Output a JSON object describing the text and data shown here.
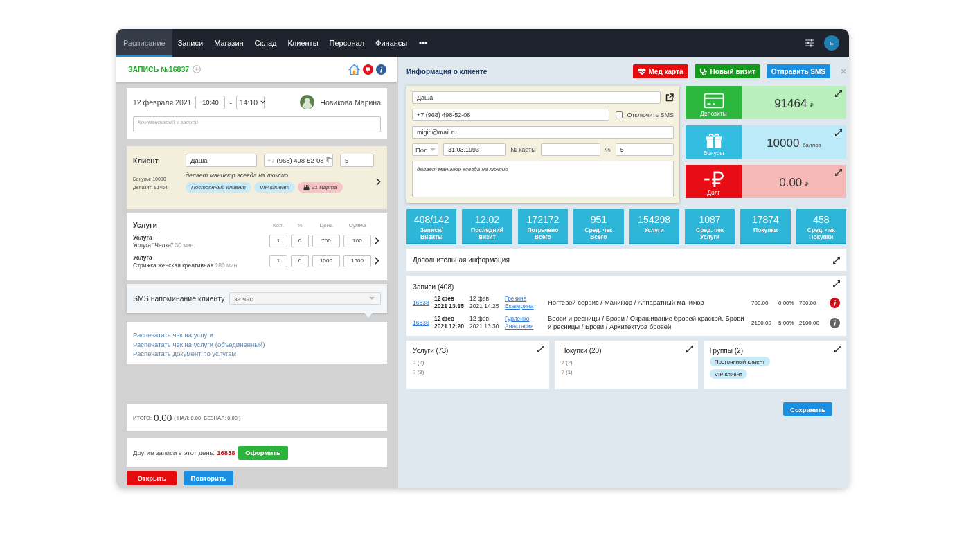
{
  "nav": {
    "tabs": [
      {
        "label": "Расписание",
        "selected": true
      },
      {
        "label": "Записи",
        "selected": false
      },
      {
        "label": "Магазин",
        "selected": false
      },
      {
        "label": "Склад",
        "selected": false
      },
      {
        "label": "Клиенты",
        "selected": false
      },
      {
        "label": "Персонал",
        "selected": false
      },
      {
        "label": "Финансы",
        "selected": false
      }
    ],
    "user_initial": "E"
  },
  "appointment": {
    "title": "ЗАПИСЬ №16837",
    "date": "12 февраля 2021",
    "time_start": "10:40",
    "time_separator": "-",
    "time_end": "14:10",
    "master": "Новикова Марина",
    "comment": {
      "placeholder": "Комментарий к записи"
    }
  },
  "client_card": {
    "heading": "Клиент",
    "bonuses": "Бонусы: 10000",
    "deposit": "Депозит: 91464",
    "name": "Даша",
    "phone_code": "+7",
    "phone": "(968) 498-52-08",
    "discount": "5",
    "note": "делает маникюр всегда на люксио",
    "tags": [
      {
        "label": "Постоянный клиент",
        "kind": "group"
      },
      {
        "label": "VIP клиент",
        "kind": "group"
      },
      {
        "label": "31 марта",
        "kind": "birthday"
      }
    ]
  },
  "services": {
    "heading": "Услуги",
    "columns": [
      "Кол.",
      "%",
      "Цена",
      "Сумма"
    ],
    "rows": [
      {
        "type": "Услуга",
        "name": "Услуга \"Челка\"",
        "duration": "30 мин.",
        "qty": "1",
        "discount": "0",
        "price": "700",
        "sum": "700"
      },
      {
        "type": "Услуга",
        "name": "Стрижка женская креативная",
        "duration": "180 мин.",
        "qty": "1",
        "discount": "0",
        "price": "1500",
        "sum": "1500"
      }
    ]
  },
  "sms_reminder": {
    "label": "SMS напоминание клиенту",
    "value": "за час"
  },
  "print_links": [
    "Распечатать чек на услуги",
    "Распечатать чек на услуги (объединенный)",
    "Распечатать документ по услугам"
  ],
  "total": {
    "label": "ИТОГО:",
    "amount": "0.00",
    "breakdown": "( НАЛ: 0.00, БЕЗНАЛ: 0.00 )"
  },
  "other_records": {
    "label": "Другие записи в этот день:",
    "record": "16838",
    "button": "Оформить"
  },
  "bottom_buttons": [
    {
      "label": "Открыть",
      "kind": "danger"
    },
    {
      "label": "Повторить",
      "kind": "primary"
    }
  ],
  "client_info": {
    "title": "Информация о клиенте",
    "actions": [
      {
        "label": "Мед карта",
        "kind": "medcard"
      },
      {
        "label": "Новый визит",
        "kind": "visit"
      },
      {
        "label": "Отправить SMS",
        "kind": "sms"
      }
    ],
    "form": {
      "name": "Даша",
      "phone": "+7 (968) 498-52-08",
      "sms_off": {
        "label": "Отключить SMS",
        "checked": false
      },
      "email": "migirl@mail.ru",
      "gender": {
        "placeholder": "Пол"
      },
      "birthdate": "31.03.1993",
      "card_label": "№ карты",
      "percent_label": "%",
      "percent": "5",
      "note": "делает маникюр всегда на люксио"
    }
  },
  "balances": [
    {
      "kind": "deposit",
      "label": "Депозиты",
      "value": "91464",
      "unit": "₽"
    },
    {
      "kind": "bonus",
      "label": "Бонусы",
      "value": "10000",
      "unit": "баллов"
    },
    {
      "kind": "debt",
      "label": "Долг",
      "value": "0.00",
      "unit": "₽"
    }
  ],
  "stats": [
    {
      "value": "408/142",
      "label": "Записи/ Визиты"
    },
    {
      "value": "12.02",
      "label": "Последний визит"
    },
    {
      "value": "172172",
      "label": "Потрачено Всего"
    },
    {
      "value": "951",
      "label": "Сред. чек Всего"
    },
    {
      "value": "154298",
      "label": "Услуги"
    },
    {
      "value": "1087",
      "label": "Сред. чек Услуги"
    },
    {
      "value": "17874",
      "label": "Покупки"
    },
    {
      "value": "458",
      "label": "Сред. чек Покупки"
    }
  ],
  "extra_info": {
    "title": "Дополнительная информация"
  },
  "records": {
    "title": "Записи (408)",
    "rows": [
      {
        "id": "16838",
        "start": "12 фев 2021 13:15",
        "end": "12 фев 2021 14:25",
        "client": "Грезина Екатерина",
        "service": "Ногтевой сервис / Маникюр / Аппаратный маникюр",
        "price": "700.00",
        "discount": "0.00%",
        "total": "700.00",
        "color": "#d0101a"
      },
      {
        "id": "16836",
        "start": "12 фев 2021 12:20",
        "end": "12 фев 2021 13:30",
        "client": "Гурленко Анастасия",
        "service": "Брови и ресницы / Брови / Окрашивание бровей краской, Брови и ресницы / Брови / Архитектура бровей",
        "price": "2100.00",
        "discount": "5.00%",
        "total": "2100.00",
        "color": "#666666"
      }
    ]
  },
  "summary_cards": [
    {
      "title": "Услуги (73)",
      "kind": "list",
      "items": [
        "? (2)",
        "? (3)"
      ]
    },
    {
      "title": "Покупки (20)",
      "kind": "list",
      "items": [
        "? (2)",
        "? (1)"
      ]
    },
    {
      "title": "Группы (2)",
      "kind": "tags",
      "items": [
        "Постоянный клиент",
        "VIP клиент"
      ]
    }
  ],
  "save_button": "Сохранить"
}
